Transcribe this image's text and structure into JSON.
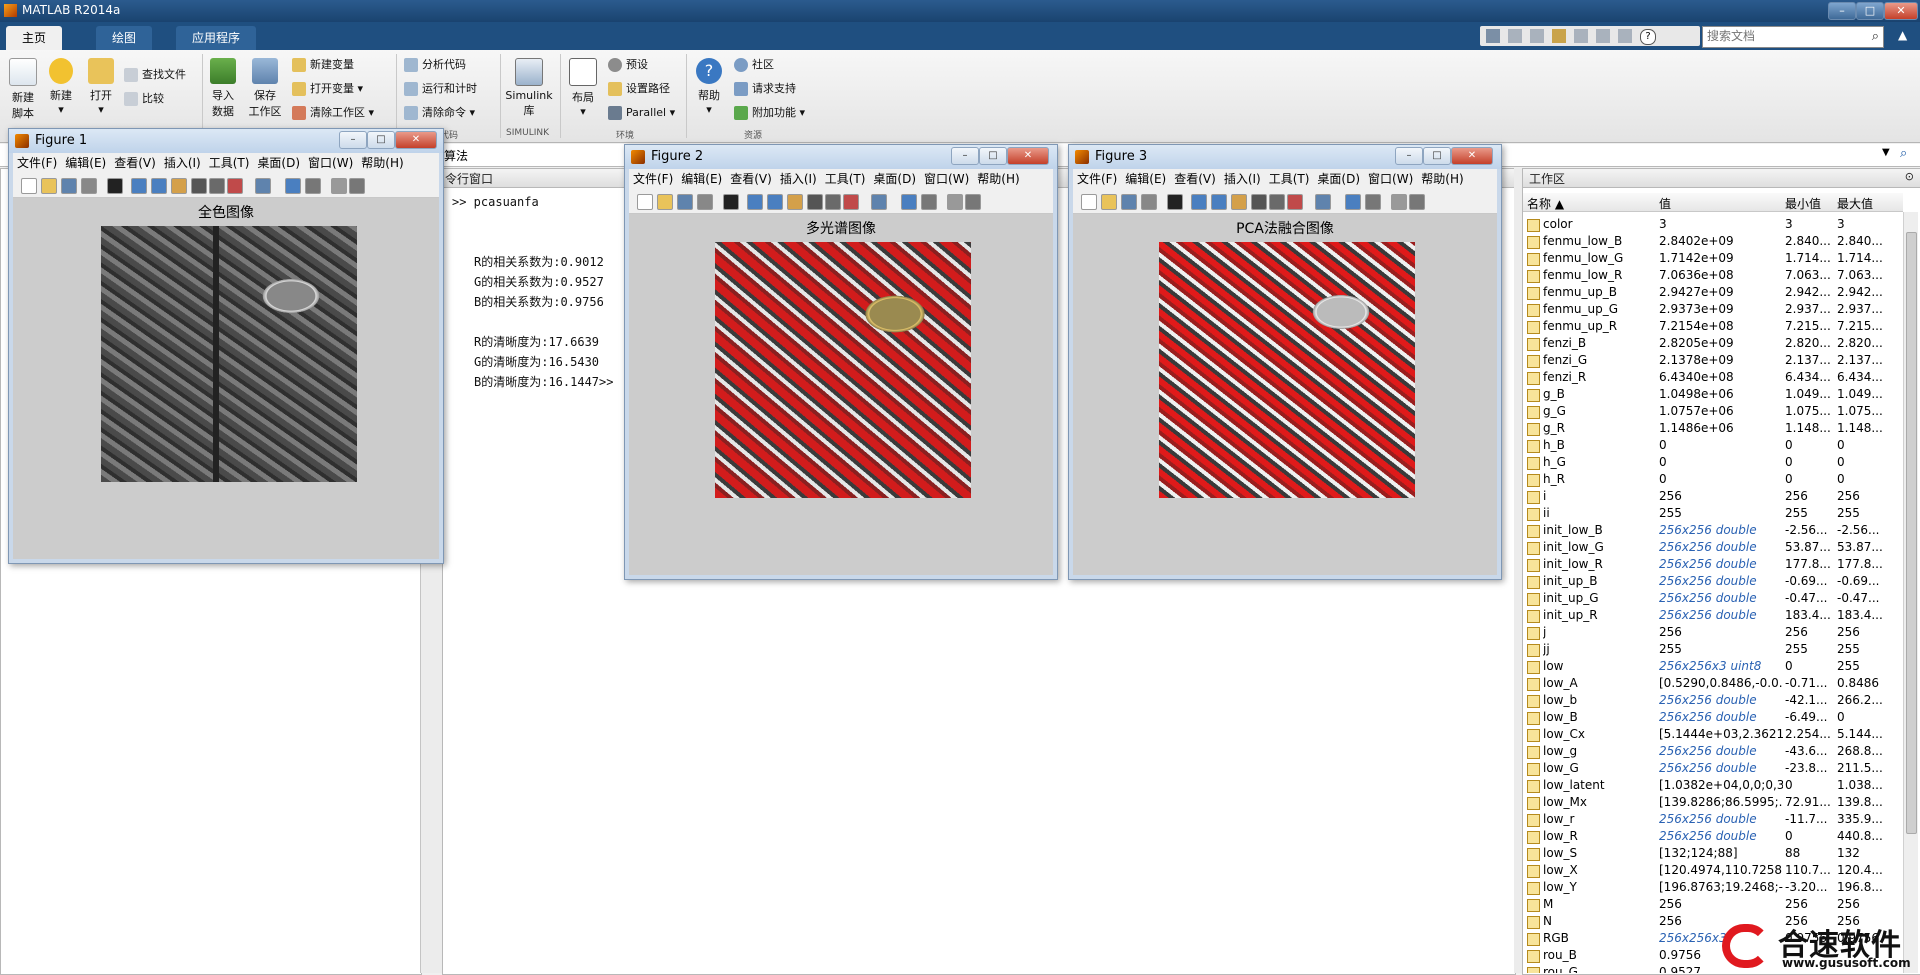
{
  "app": {
    "title": "MATLAB R2014a"
  },
  "tabs": [
    "主页",
    "绘图",
    "应用程序"
  ],
  "search": {
    "placeholder": "搜索文档"
  },
  "ribbon": {
    "new_script": [
      "新建",
      "脚本"
    ],
    "new": "新建",
    "open": "打开",
    "find_files": "查找文件",
    "compare": "比较",
    "import": [
      "导入",
      "数据"
    ],
    "save_ws": [
      "保存",
      "工作区"
    ],
    "new_var": "新建变量",
    "open_var": "打开变量",
    "clear_ws": "清除工作区",
    "analyze": "分析代码",
    "run_time": "运行和计时",
    "clear_cmd": "清除命令",
    "simulink": [
      "Simulink",
      "库"
    ],
    "layout": "布局",
    "prefs": "预设",
    "set_path": "设置路径",
    "parallel": "Parallel",
    "help": "帮助",
    "community": "社区",
    "request_support": "请求支持",
    "addons": "附加功能",
    "groups": [
      "代码",
      "SIMULINK",
      "环境",
      "资源"
    ]
  },
  "current_folder": {
    "label": "算法"
  },
  "command_window": {
    "header": "令行窗口",
    "lines": [
      ">> pcasuanfa",
      "",
      "",
      "R的相关系数为:0.9012",
      "G的相关系数为:0.9527",
      "B的相关系数为:0.9756",
      "",
      "R的清晰度为:17.6639",
      "G的清晰度为:16.5430",
      "B的清晰度为:16.1447>>"
    ]
  },
  "figures": [
    {
      "title": "Figure 1",
      "caption": "全色图像"
    },
    {
      "title": "Figure 2",
      "caption": "多光谱图像"
    },
    {
      "title": "Figure 3",
      "caption": "PCA法融合图像"
    }
  ],
  "figure_menu": [
    "文件(F)",
    "编辑(E)",
    "查看(V)",
    "插入(I)",
    "工具(T)",
    "桌面(D)",
    "窗口(W)",
    "帮助(H)"
  ],
  "workspace": {
    "header": "工作区",
    "columns": [
      "名称 ▲",
      "值",
      "最小值",
      "最大值"
    ],
    "rows": [
      [
        "color",
        "3",
        "3",
        "3",
        false
      ],
      [
        "fenmu_low_B",
        "2.8402e+09",
        "2.840...",
        "2.840...",
        false
      ],
      [
        "fenmu_low_G",
        "1.7142e+09",
        "1.714...",
        "1.714...",
        false
      ],
      [
        "fenmu_low_R",
        "7.0636e+08",
        "7.063...",
        "7.063...",
        false
      ],
      [
        "fenmu_up_B",
        "2.9427e+09",
        "2.942...",
        "2.942...",
        false
      ],
      [
        "fenmu_up_G",
        "2.9373e+09",
        "2.937...",
        "2.937...",
        false
      ],
      [
        "fenmu_up_R",
        "7.2154e+08",
        "7.215...",
        "7.215...",
        false
      ],
      [
        "fenzi_B",
        "2.8205e+09",
        "2.820...",
        "2.820...",
        false
      ],
      [
        "fenzi_G",
        "2.1378e+09",
        "2.137...",
        "2.137...",
        false
      ],
      [
        "fenzi_R",
        "6.4340e+08",
        "6.434...",
        "6.434...",
        false
      ],
      [
        "g_B",
        "1.0498e+06",
        "1.049...",
        "1.049...",
        false
      ],
      [
        "g_G",
        "1.0757e+06",
        "1.075...",
        "1.075...",
        false
      ],
      [
        "g_R",
        "1.1486e+06",
        "1.148...",
        "1.148...",
        false
      ],
      [
        "h_B",
        "0",
        "0",
        "0",
        false
      ],
      [
        "h_G",
        "0",
        "0",
        "0",
        false
      ],
      [
        "h_R",
        "0",
        "0",
        "0",
        false
      ],
      [
        "i",
        "256",
        "256",
        "256",
        false
      ],
      [
        "ii",
        "255",
        "255",
        "255",
        false
      ],
      [
        "init_low_B",
        "256x256 double",
        "-2.56...",
        "-2.56...",
        true
      ],
      [
        "init_low_G",
        "256x256 double",
        "53.87...",
        "53.87...",
        true
      ],
      [
        "init_low_R",
        "256x256 double",
        "177.8...",
        "177.8...",
        true
      ],
      [
        "init_up_B",
        "256x256 double",
        "-0.69...",
        "-0.69...",
        true
      ],
      [
        "init_up_G",
        "256x256 double",
        "-0.47...",
        "-0.47...",
        true
      ],
      [
        "init_up_R",
        "256x256 double",
        "183.4...",
        "183.4...",
        true
      ],
      [
        "j",
        "256",
        "256",
        "256",
        false
      ],
      [
        "jj",
        "255",
        "255",
        "255",
        false
      ],
      [
        "low",
        "256x256x3 uint8",
        "0",
        "255",
        true
      ],
      [
        "low_A",
        "[0.5290,0.8486,-0.0...",
        "-0.71...",
        "0.8486",
        false
      ],
      [
        "low_b",
        "256x256 double",
        "-42.1...",
        "266.2...",
        true
      ],
      [
        "low_B",
        "256x256 double",
        "-6.49...",
        "0",
        true
      ],
      [
        "low_Cx",
        "[5.1444e+03,2.3621...",
        "2.254...",
        "5.144...",
        false
      ],
      [
        "low_g",
        "256x256 double",
        "-43.6...",
        "268.8...",
        true
      ],
      [
        "low_G",
        "256x256 double",
        "-23.8...",
        "211.5...",
        true
      ],
      [
        "low_latent",
        "[1.0382e+04,0,0;0,3...",
        "0",
        "1.038...",
        false
      ],
      [
        "low_Mx",
        "[139.8286;86.5995;...",
        "72.91...",
        "139.8...",
        false
      ],
      [
        "low_r",
        "256x256 double",
        "-11.7...",
        "335.9...",
        true
      ],
      [
        "low_R",
        "256x256 double",
        "0",
        "440.8...",
        true
      ],
      [
        "low_S",
        "[132;124;88]",
        "88",
        "132",
        false
      ],
      [
        "low_X",
        "[120.4974,110.7258...",
        "110.7...",
        "120.4...",
        false
      ],
      [
        "low_Y",
        "[196.8763;19.2468;-...",
        "-3.20...",
        "196.8...",
        false
      ],
      [
        "M",
        "256",
        "256",
        "256",
        false
      ],
      [
        "N",
        "256",
        "256",
        "256",
        false
      ],
      [
        "RGB",
        "256x256x3",
        "0.9756",
        "0.9756",
        true
      ],
      [
        "rou_B",
        "0.9756",
        "",
        "",
        false
      ],
      [
        "rou_G",
        "0.9527",
        "",
        "",
        false
      ]
    ]
  },
  "watermark": {
    "brand": "合速软件",
    "url": "www.gususoft.com"
  }
}
